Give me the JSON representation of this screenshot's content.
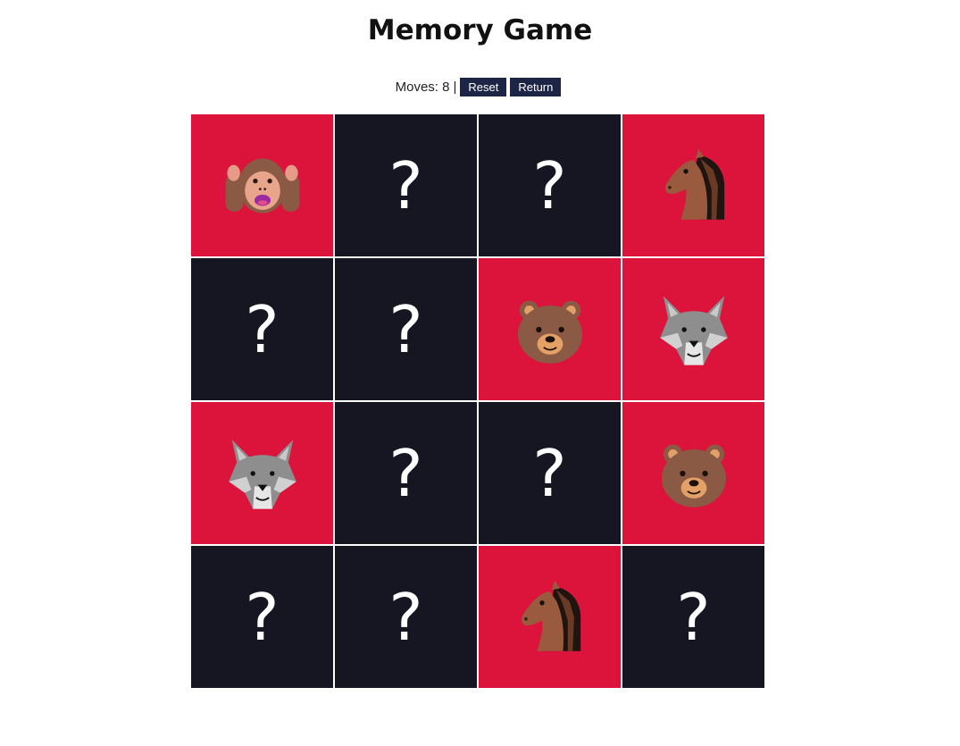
{
  "title": "Memory Game",
  "controls": {
    "moves_label": "Moves: 8",
    "separator": "|",
    "reset_label": "Reset",
    "return_label": "Return"
  },
  "colors": {
    "hidden_card": "#151622",
    "revealed_card": "#dc143c",
    "button_bg": "#1d2547"
  },
  "board": {
    "cards": [
      {
        "state": "revealed",
        "icon": "monkey-hear-no-evil-icon",
        "label": "🙉"
      },
      {
        "state": "hidden",
        "label": "?"
      },
      {
        "state": "hidden",
        "label": "?"
      },
      {
        "state": "revealed",
        "icon": "horse-icon",
        "label": "🐴"
      },
      {
        "state": "hidden",
        "label": "?"
      },
      {
        "state": "hidden",
        "label": "?"
      },
      {
        "state": "revealed",
        "icon": "bear-icon",
        "label": "🐻"
      },
      {
        "state": "revealed",
        "icon": "wolf-icon",
        "label": "🐺"
      },
      {
        "state": "revealed",
        "icon": "wolf-icon",
        "label": "🐺"
      },
      {
        "state": "hidden",
        "label": "?"
      },
      {
        "state": "hidden",
        "label": "?"
      },
      {
        "state": "revealed",
        "icon": "bear-icon",
        "label": "🐻"
      },
      {
        "state": "hidden",
        "label": "?"
      },
      {
        "state": "hidden",
        "label": "?"
      },
      {
        "state": "revealed",
        "icon": "horse-icon",
        "label": "🐴"
      },
      {
        "state": "hidden",
        "label": "?"
      }
    ]
  }
}
